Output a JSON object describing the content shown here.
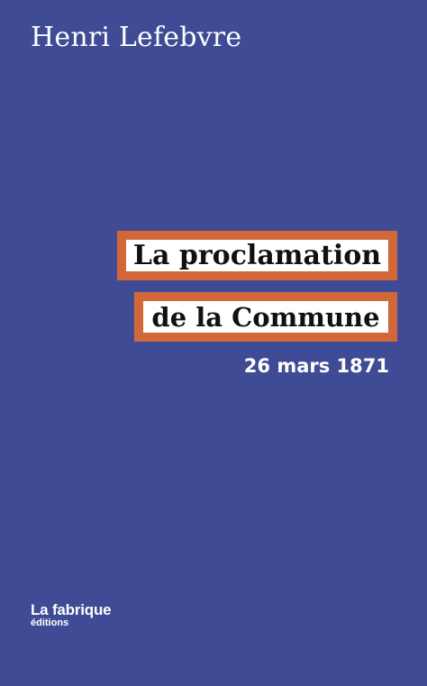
{
  "cover": {
    "author": "Henri Lefebvre",
    "title_line1": "La proclamation",
    "title_line2": "de la Commune",
    "subtitle": "26 mars 1871",
    "publisher_name": "La fabrique",
    "publisher_sub": "éditions"
  },
  "colors": {
    "background": "#3f4b95",
    "title_border": "#d2683a",
    "title_fill": "#ffffff",
    "text_light": "#ffffff",
    "text_dark": "#111111"
  }
}
